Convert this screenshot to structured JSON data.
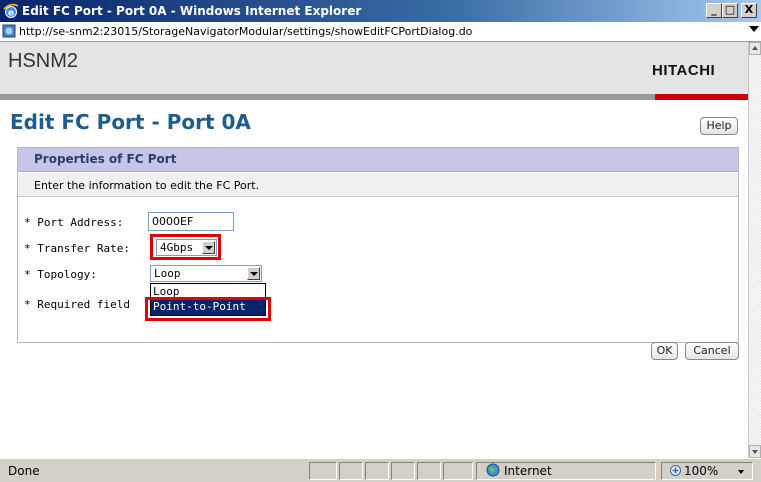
{
  "window": {
    "title": "Edit FC Port - Port 0A - Windows Internet Explorer",
    "minimize_glyph": "_",
    "maximize_glyph": "□",
    "close_glyph": "X"
  },
  "address": {
    "url": "http://se-snm2:23015/StorageNavigatorModular/settings/showEditFCPortDialog.do"
  },
  "header": {
    "app_name": "HSNM2",
    "logo": "HITACHI",
    "colors": {
      "stripe_gray": "#9a9a9a",
      "stripe_red": "#cc0000"
    }
  },
  "page": {
    "title": "Edit FC Port - Port 0A",
    "help_label": "Help"
  },
  "panel": {
    "heading": "Properties of FC Port",
    "description": "Enter the information to edit the FC Port."
  },
  "form": {
    "port_address_label": "* Port Address:",
    "port_address_value": "0000EF",
    "transfer_rate_label": "* Transfer Rate:",
    "transfer_rate_value": "4Gbps",
    "topology_label": "* Topology:",
    "topology_value": "Loop",
    "topology_options": [
      "Loop",
      "Point-to-Point"
    ],
    "required_note": "* Required field"
  },
  "buttons": {
    "ok_label": "OK",
    "cancel_label": "Cancel"
  },
  "statusbar": {
    "status": "Done",
    "zone": "Internet",
    "zoom": "100%"
  },
  "highlight_color": "#e00000"
}
